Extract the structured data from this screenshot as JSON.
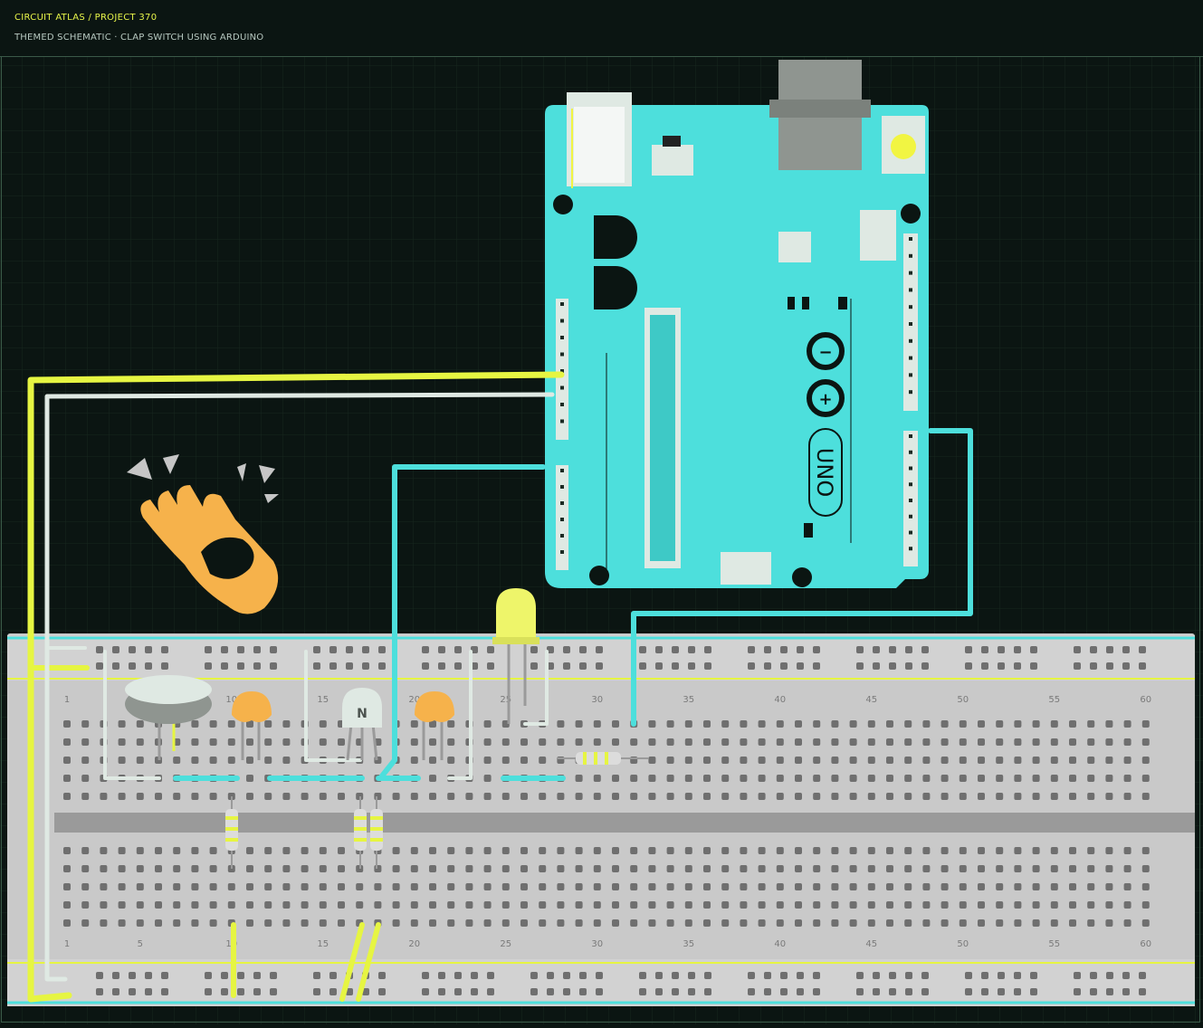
{
  "header": {
    "title": "CIRCUIT ATLAS / PROJECT 370",
    "subtitle": "THEMED SCHEMATIC · CLAP SWITCH USING ARDUINO"
  },
  "board": {
    "label": "UNO",
    "color": "#4ddfdc"
  },
  "components": {
    "transistor_label": "N"
  },
  "breadboard": {
    "column_numbers": [
      "1",
      "5",
      "10",
      "15",
      "20",
      "25",
      "30",
      "35",
      "40",
      "45",
      "50",
      "55",
      "60"
    ]
  },
  "colors": {
    "background": "#0b1512",
    "grid": "#1a2a23",
    "wire_yellow": "#e6f542",
    "wire_white": "#dfe9e3",
    "wire_cyan": "#4ddfdc",
    "led": "#eef56a",
    "hand": "#f6b24b",
    "breadboard": "#c6c6c6"
  }
}
